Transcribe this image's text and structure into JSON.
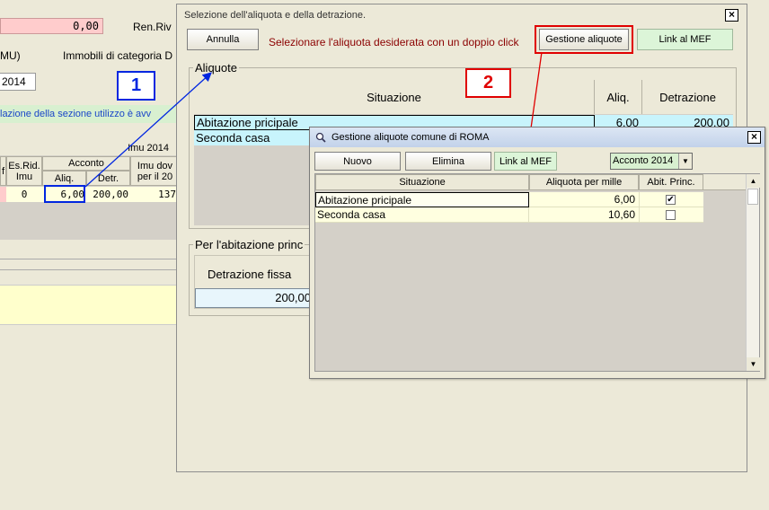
{
  "background": {
    "amount_field": "0,00",
    "ren_riv_label": "Ren.Riv",
    "imu_label": "MU)",
    "immobili_label": "Immobili di categoria D",
    "year_tab": "2014",
    "info_bar_text": "lazione della sezione utilizzo è avv",
    "imu_year_header": "Imu 2014",
    "es_rid_header": "Es.Rid.\nImu",
    "es_rid_line1": "Es.Rid.",
    "es_rid_line2": "Imu",
    "acconto_header": "Acconto",
    "alig_header": "Aliq.",
    "detr_header": "Detr.",
    "imu_dov_line1": "Imu dov",
    "imu_dov_line2": "per il 20",
    "f_header": "f",
    "row_es_rid": "0",
    "row_alig": "6,00",
    "row_detr": "200,00",
    "row_imu_dov": "137"
  },
  "main_dialog": {
    "title": "Selezione dell'aliquota e della detrazione.",
    "annulla_button": "Annulla",
    "instruction": "Selezionare l'aliquota desiderata con un doppio click",
    "gestione_button": "Gestione aliquote",
    "link_mef_button": "Link al MEF",
    "aliquote_group": "Aliquote",
    "columns": [
      "Situazione",
      "Aliq.",
      "Detrazione"
    ],
    "rows": [
      {
        "situazione": "Abitazione pricipale",
        "aliq": "6,00",
        "detrazione": "200,00"
      },
      {
        "situazione": "Seconda casa",
        "aliq": "",
        "detrazione": ""
      }
    ],
    "abitazione_group": "Per l'abitazione princ",
    "detrazione_fissa_label": "Detrazione fissa",
    "detrazione_fissa_value": "200,00"
  },
  "annotations": {
    "marker_1": "1",
    "marker_2": "2"
  },
  "sub_dialog": {
    "title": "Gestione aliquote comune di ROMA",
    "nuovo_button": "Nuovo",
    "elimina_button": "Elimina",
    "link_mef_button": "Link al MEF",
    "period_select": "Acconto 2014",
    "columns": [
      "Situazione",
      "Aliquota per mille",
      "Abit. Princ."
    ],
    "rows": [
      {
        "situazione": "Abitazione pricipale",
        "aliquota": "6,00",
        "abit_princ": "✔"
      },
      {
        "situazione": "Seconda casa",
        "aliquota": "10,60",
        "abit_princ": ""
      }
    ]
  },
  "colors": {
    "highlight_red": "#e00000",
    "highlight_blue": "#0026e0",
    "info_green": "#d8f0d0",
    "yellow_area": "#ffffcc"
  }
}
